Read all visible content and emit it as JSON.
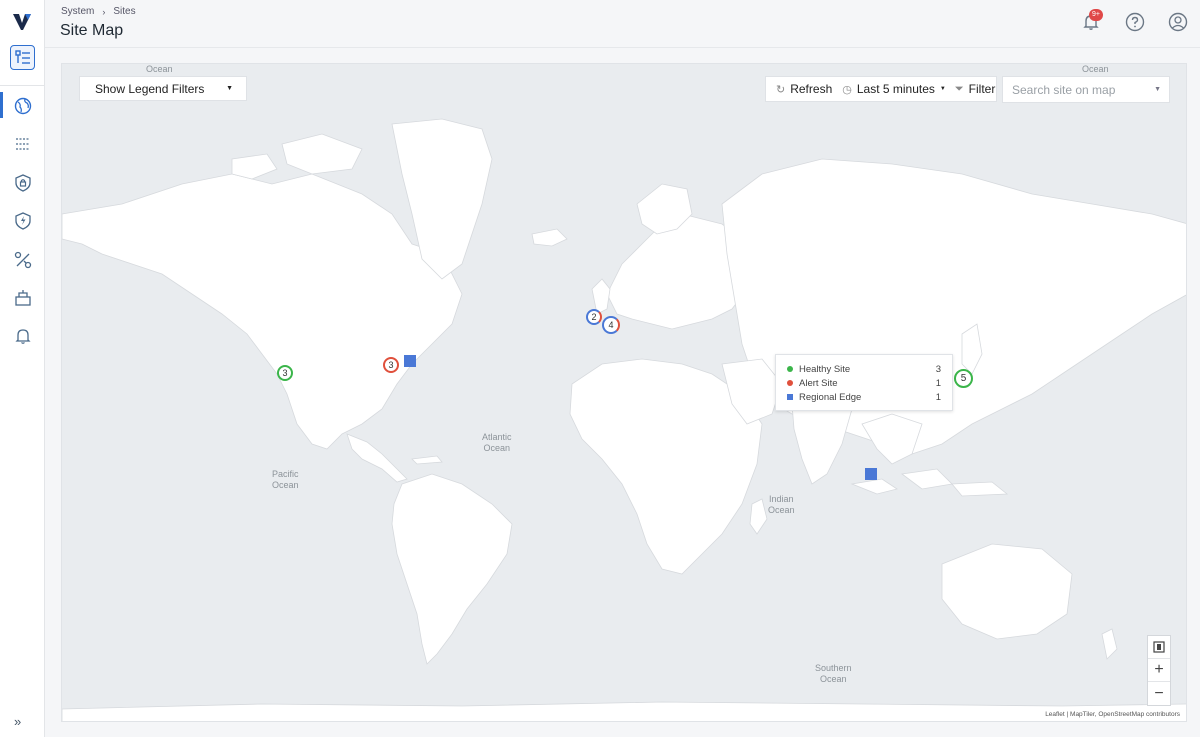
{
  "breadcrumb": {
    "items": [
      "System",
      "Sites"
    ]
  },
  "page": {
    "title": "Site Map"
  },
  "notifications": {
    "badge": "9+"
  },
  "map": {
    "legend_filter": {
      "label": "Show Legend Filters"
    },
    "toolbar": {
      "refresh_label": "Refresh",
      "time_range": "Last 5 minutes",
      "filter_label": "Filter"
    },
    "search": {
      "placeholder": "Search site on map"
    },
    "ocean_labels": {
      "top_left": "Ocean",
      "top_right": "Ocean",
      "atlantic": "Atlantic\nOcean",
      "pacific": "Pacific\nOcean",
      "indian": "Indian\nOcean",
      "southern": "Southern\nOcean"
    },
    "markers": [
      {
        "label": "3",
        "status": "healthy"
      },
      {
        "label": "3",
        "status": "alert"
      },
      {
        "label": "2",
        "status": "mixed"
      },
      {
        "label": "4",
        "status": "mixed"
      },
      {
        "label": "5",
        "status": "healthy"
      }
    ],
    "popup": {
      "rows": [
        {
          "label": "Healthy Site",
          "count": "3",
          "color": "#3bb54a"
        },
        {
          "label": "Alert Site",
          "count": "1",
          "color": "#e0503c"
        },
        {
          "label": "Regional Edge",
          "count": "1",
          "color": "#4a78d6"
        }
      ]
    },
    "attribution": {
      "leaflet": "Leaflet",
      "maptiler": "MapTiler",
      "osm": "OpenStreetMap contributors"
    }
  },
  "colors": {
    "accent": "#2f6fcf",
    "healthy": "#3bb54a",
    "alert": "#e0503c",
    "regional_edge": "#4a78d6"
  }
}
